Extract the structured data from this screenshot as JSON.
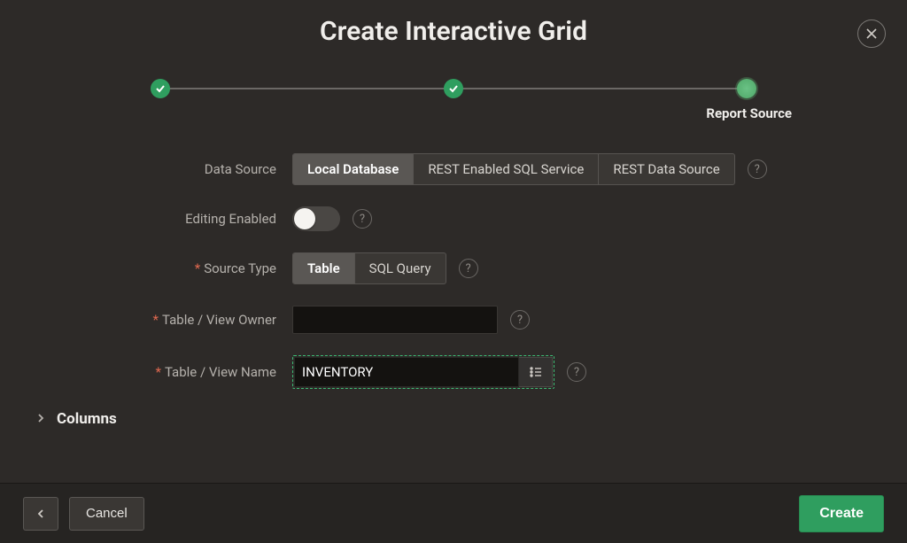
{
  "dialog": {
    "title": "Create Interactive Grid"
  },
  "wizard": {
    "current_step_label": "Report Source"
  },
  "form": {
    "data_source": {
      "label": "Data Source",
      "options": {
        "local": "Local Database",
        "rest_sql": "REST Enabled SQL Service",
        "rest_data": "REST Data Source"
      },
      "selected": "local"
    },
    "editing_enabled": {
      "label": "Editing Enabled",
      "value": false
    },
    "source_type": {
      "label": "Source Type",
      "options": {
        "table": "Table",
        "sql": "SQL Query"
      },
      "selected": "table"
    },
    "table_owner": {
      "label": "Table / View Owner",
      "value": ""
    },
    "table_name": {
      "label": "Table / View Name",
      "value": "INVENTORY"
    },
    "columns_section": "Columns"
  },
  "footer": {
    "back_label": "Back",
    "cancel": "Cancel",
    "create": "Create"
  },
  "glyphs": {
    "help": "?"
  }
}
